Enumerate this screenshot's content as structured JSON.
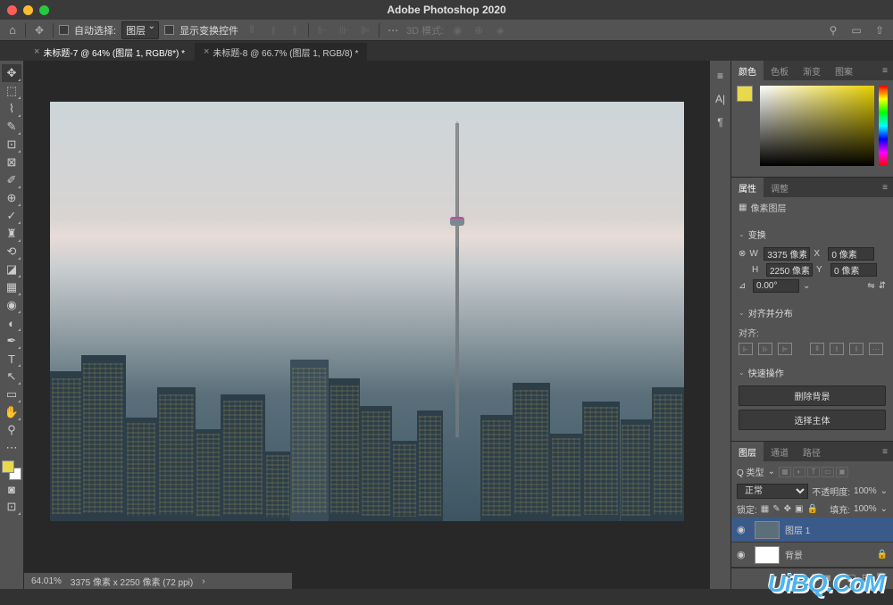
{
  "app": {
    "title": "Adobe Photoshop 2020"
  },
  "options": {
    "home_icon": "⌂",
    "auto_select_label": "自动选择:",
    "auto_select_value": "图层",
    "show_transform_label": "显示变换控件",
    "mode_3d_label": "3D 模式:"
  },
  "tabs": [
    {
      "label": "未标题-7 @ 64% (图层 1, RGB/8*) *",
      "active": true
    },
    {
      "label": "未标题-8 @ 66.7% (图层 1, RGB/8) *",
      "active": false
    }
  ],
  "status": {
    "zoom": "64.01%",
    "dims": "3375 像素 x 2250 像素 (72 ppi)"
  },
  "color_panel": {
    "tabs": [
      "颜色",
      "色板",
      "渐变",
      "图案"
    ],
    "active": 0
  },
  "properties": {
    "tabs": [
      "属性",
      "调整"
    ],
    "type_label": "像素图层",
    "transform_label": "变换",
    "w_label": "W",
    "w_value": "3375 像素",
    "x_label": "X",
    "x_value": "0 像素",
    "h_label": "H",
    "h_value": "2250 像素",
    "y_label": "Y",
    "y_value": "0 像素",
    "angle_label": "⊿",
    "angle_value": "0.00°",
    "align_label": "对齐并分布",
    "align_sub": "对齐:",
    "quick_label": "快速操作",
    "quick_remove_bg": "删除背景",
    "quick_select_subject": "选择主体"
  },
  "layers": {
    "tabs": [
      "图层",
      "通道",
      "路径"
    ],
    "kind_label": "Q 类型",
    "blend_mode": "正常",
    "opacity_label": "不透明度:",
    "opacity_value": "100%",
    "lock_label": "锁定:",
    "fill_label": "填充:",
    "fill_value": "100%",
    "items": [
      {
        "name": "图层 1",
        "visible": true,
        "selected": true,
        "locked": false
      },
      {
        "name": "背景",
        "visible": true,
        "selected": false,
        "locked": true
      }
    ]
  },
  "watermark": "UiBQ.CoM"
}
